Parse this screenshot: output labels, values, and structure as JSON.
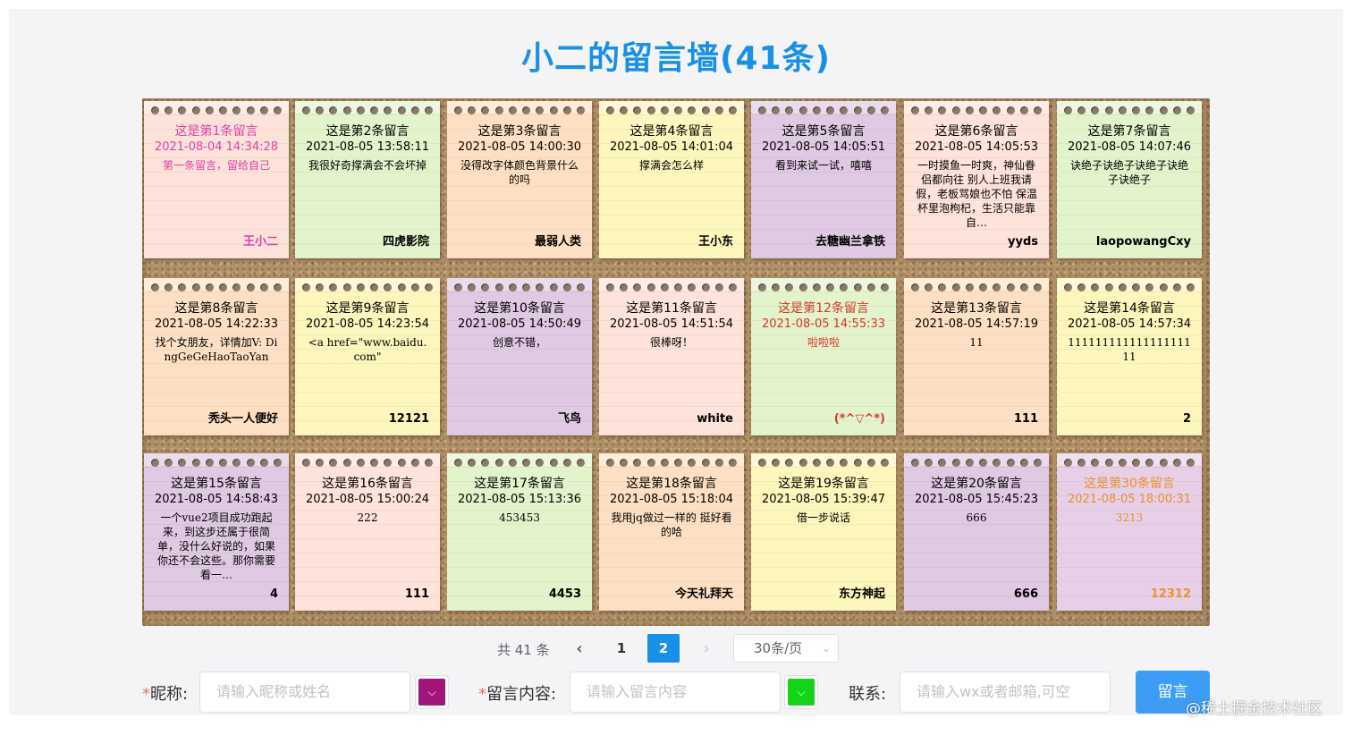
{
  "page_title": "小二的留言墙(41条)",
  "notes": [
    {
      "title": "这是第1条留言",
      "time": "2021-08-04 14:34:28",
      "body": "第一条留言，留给自己",
      "author": "王小二",
      "bg": "#fde3da",
      "color": "#e040a8"
    },
    {
      "title": "这是第2条留言",
      "time": "2021-08-05 13:58:11",
      "body": "我很好奇撑满会不会坏掉",
      "author": "四虎影院",
      "bg": "#e3f3cc",
      "color": "#000000"
    },
    {
      "title": "这是第3条留言",
      "time": "2021-08-05 14:00:30",
      "body": "没得改字体颜色背景什么的吗",
      "author": "最弱人类",
      "bg": "#fde0c4",
      "color": "#000000"
    },
    {
      "title": "这是第4条留言",
      "time": "2021-08-05 14:01:04",
      "body": "撑满会怎么样",
      "author": "王小东",
      "bg": "#fdf6bd",
      "color": "#000000"
    },
    {
      "title": "这是第5条留言",
      "time": "2021-08-05 14:05:51",
      "body": "看到来试一试，嘻嘻",
      "author": "去糖幽兰拿铁",
      "bg": "#e0c9e3",
      "color": "#000000"
    },
    {
      "title": "这是第6条留言",
      "time": "2021-08-05 14:05:53",
      "body": "一时摸鱼一时爽，神仙眷侣都向往 别人上班我请假，老板骂娘也不怕 保温杯里泡枸杞，生活只能靠自…",
      "author": "yyds",
      "bg": "#fde3da",
      "color": "#000000"
    },
    {
      "title": "这是第7条留言",
      "time": "2021-08-05 14:07:46",
      "body": "诀绝子诀绝子诀绝子诀绝子诀绝子",
      "author": "laopowangCxy",
      "bg": "#e3f3cc",
      "color": "#000000"
    },
    {
      "title": "这是第8条留言",
      "time": "2021-08-05 14:22:33",
      "body": "找个女朋友，详情加V: DingGeGeHaoTaoYan",
      "author": "秃头一人便好",
      "bg": "#fde0c4",
      "color": "#000000"
    },
    {
      "title": "这是第9条留言",
      "time": "2021-08-05 14:23:54",
      "body": "<a href=\"www.baidu.com\"",
      "author": "12121",
      "bg": "#fdf6bd",
      "color": "#000000"
    },
    {
      "title": "这是第10条留言",
      "time": "2021-08-05 14:50:49",
      "body": "创意不错，",
      "author": "飞鸟",
      "bg": "#e0c9e3",
      "color": "#000000"
    },
    {
      "title": "这是第11条留言",
      "time": "2021-08-05 14:51:54",
      "body": "很棒呀！",
      "author": "white",
      "bg": "#fde3da",
      "color": "#000000"
    },
    {
      "title": "这是第12条留言",
      "time": "2021-08-05 14:55:33",
      "body": "啦啦啦",
      "author": "(*^▽^*)",
      "bg": "#e3f3cc",
      "color": "#d9342b"
    },
    {
      "title": "这是第13条留言",
      "time": "2021-08-05 14:57:19",
      "body": "11",
      "author": "111",
      "bg": "#fde0c4",
      "color": "#000000"
    },
    {
      "title": "这是第14条留言",
      "time": "2021-08-05 14:57:34",
      "body": "11111111111111111111",
      "author": "2",
      "bg": "#fdf6bd",
      "color": "#000000"
    },
    {
      "title": "这是第15条留言",
      "time": "2021-08-05 14:58:43",
      "body": "一个vue2项目成功跑起来，到这步还属于很简单，没什么好说的，如果你还不会这些。那你需要看一…",
      "author": "4",
      "bg": "#e0c9e3",
      "color": "#000000"
    },
    {
      "title": "这是第16条留言",
      "time": "2021-08-05 15:00:24",
      "body": "222",
      "author": "111",
      "bg": "#fde3da",
      "color": "#000000"
    },
    {
      "title": "这是第17条留言",
      "time": "2021-08-05 15:13:36",
      "body": "453453",
      "author": "4453",
      "bg": "#e3f3cc",
      "color": "#000000"
    },
    {
      "title": "这是第18条留言",
      "time": "2021-08-05 15:18:04",
      "body": "我用jq做过一样的 挺好看的哈",
      "author": "今天礼拜天",
      "bg": "#fde0c4",
      "color": "#000000"
    },
    {
      "title": "这是第19条留言",
      "time": "2021-08-05 15:39:47",
      "body": "借一步说话",
      "author": "东方神起",
      "bg": "#fdf6bd",
      "color": "#000000"
    },
    {
      "title": "这是第20条留言",
      "time": "2021-08-05 15:45:23",
      "body": "666",
      "author": "666",
      "bg": "#e0c9e3",
      "color": "#000000"
    },
    {
      "title": "这是第30条留言",
      "time": "2021-08-05 18:00:31",
      "body": "3213",
      "author": "12312",
      "bg": "#e8cfe8",
      "color": "#e8912e"
    }
  ],
  "pagination": {
    "total": "共 41 条",
    "prev": "‹",
    "pages": [
      "1",
      "2"
    ],
    "active_page": "2",
    "next": "›",
    "page_size": "30条/页"
  },
  "form": {
    "nickname_required": "*",
    "nickname_label": "昵称:",
    "nickname_placeholder": "请输入昵称或姓名",
    "nickname_color": "#a0167a",
    "content_required": "*",
    "content_label": "留言内容:",
    "content_placeholder": "请输入留言内容",
    "content_color": "#14d41a",
    "contact_label": "联系:",
    "contact_placeholder": "请输入wx或者邮箱,可空",
    "submit_label": "留言"
  },
  "watermark": "@稀土掘金技术社区"
}
